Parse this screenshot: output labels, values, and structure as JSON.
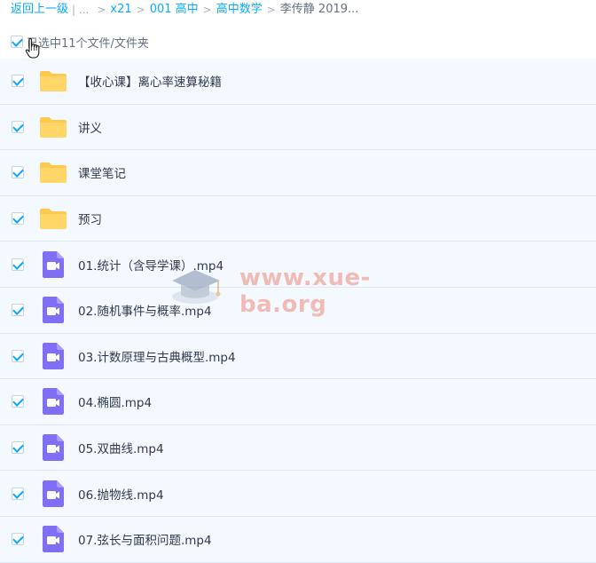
{
  "breadcrumb": {
    "back": "返回上一级",
    "ellipsis_sep": "| ...",
    "sep": ">",
    "items": [
      "x21",
      "001 高中",
      "高中数学"
    ],
    "current": "李传静 2019..."
  },
  "selection": {
    "label": "已选中11个文件/文件夹",
    "checked": true
  },
  "files": [
    {
      "name": "【收心课】离心率速算秘籍",
      "type": "folder",
      "icon": "folder-icon"
    },
    {
      "name": "讲义",
      "type": "folder",
      "icon": "folder-icon"
    },
    {
      "name": "课堂笔记",
      "type": "folder",
      "icon": "folder-icon"
    },
    {
      "name": "预习",
      "type": "folder",
      "icon": "folder-icon"
    },
    {
      "name": "01.统计（含导学课）.mp4",
      "type": "video",
      "icon": "video-file-icon"
    },
    {
      "name": "02.随机事件与概率.mp4",
      "type": "video",
      "icon": "video-file-icon"
    },
    {
      "name": "03.计数原理与古典概型.mp4",
      "type": "video",
      "icon": "video-file-icon"
    },
    {
      "name": "04.椭圆.mp4",
      "type": "video",
      "icon": "video-file-icon"
    },
    {
      "name": "05.双曲线.mp4",
      "type": "video",
      "icon": "video-file-icon"
    },
    {
      "name": "06.抛物线.mp4",
      "type": "video",
      "icon": "video-file-icon"
    },
    {
      "name": "07.弦长与面积问题.mp4",
      "type": "video",
      "icon": "video-file-icon"
    }
  ],
  "watermark": {
    "text": "www.xue-ba.org"
  },
  "colors": {
    "accent": "#06a7ff",
    "folder": "#ffc94d",
    "video": "#7f6ff5",
    "row_bg": "#f4f9ff"
  }
}
